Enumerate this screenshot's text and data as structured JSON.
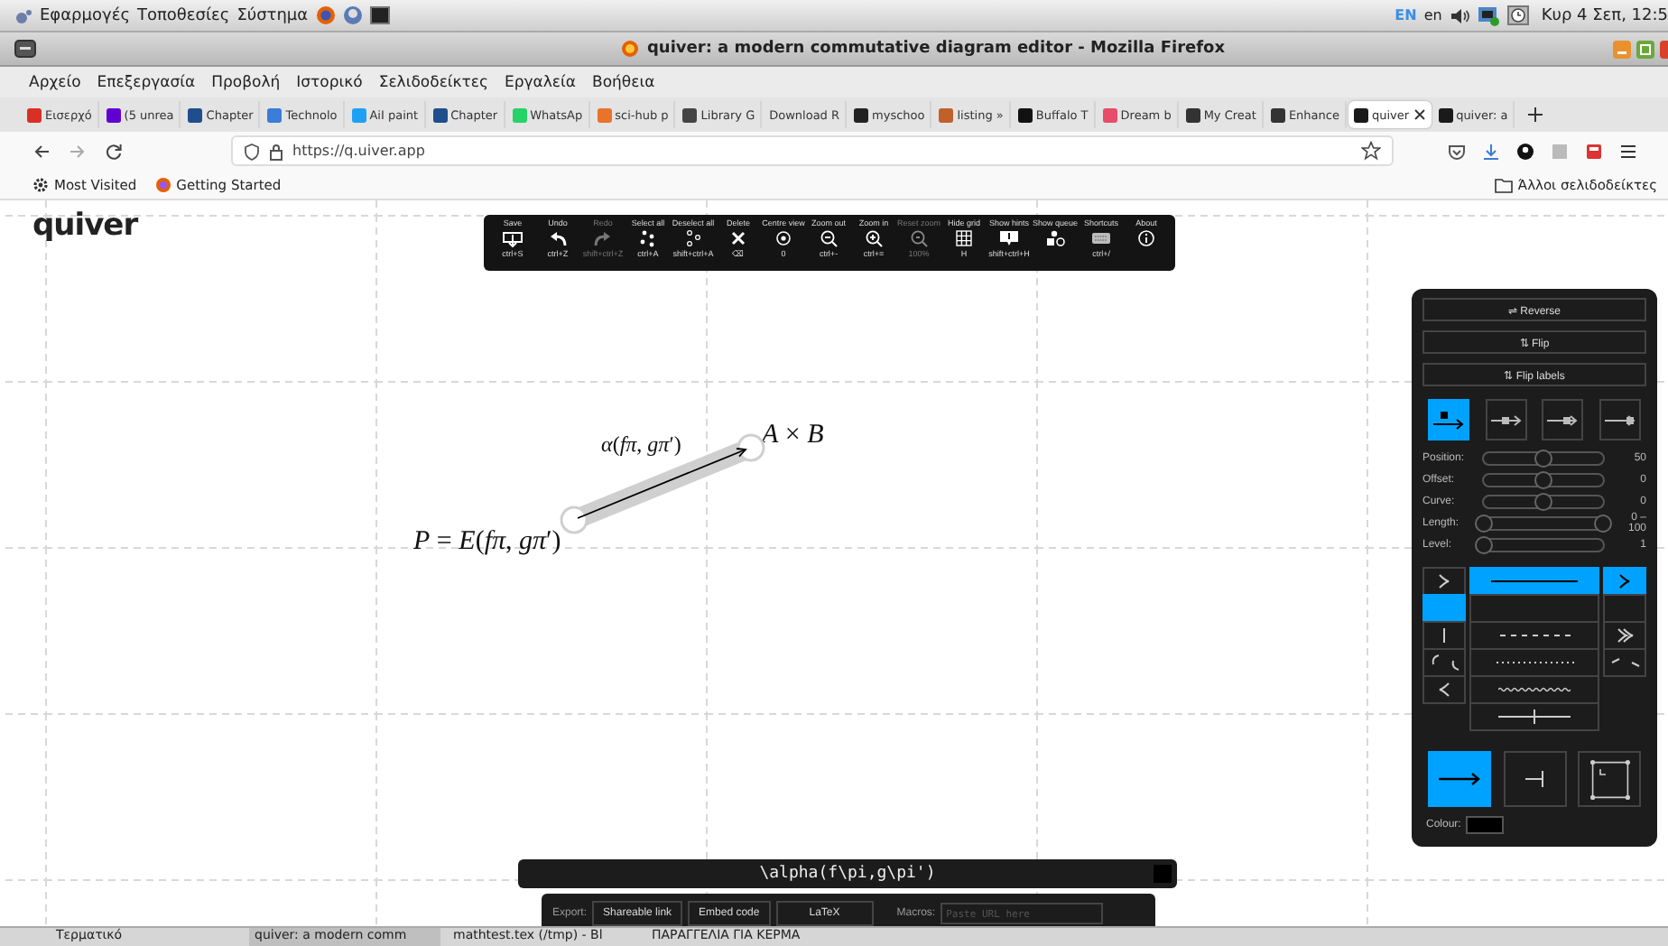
{
  "system_panel": {
    "menus": [
      "Εφαρμογές",
      "Τοποθεσίες",
      "Σύστημα"
    ],
    "keyboard_layout": "EN",
    "language": "en",
    "clock": "Κυρ  4 Σεπ, 12:5"
  },
  "window": {
    "title": "quiver: a modern commutative diagram editor - Mozilla Firefox"
  },
  "menu_bar": [
    "Αρχείο",
    "Επεξεργασία",
    "Προβολή",
    "Ιστορικό",
    "Σελιδοδείκτες",
    "Εργαλεία",
    "Βοήθεια"
  ],
  "tabs": [
    {
      "label": "Εισερχό",
      "selected": false,
      "color": "#d93025"
    },
    {
      "label": "(5 unrea",
      "selected": false,
      "color": "#6001d2"
    },
    {
      "label": "Chapter",
      "selected": false,
      "color": "#1f4e8c"
    },
    {
      "label": "Technolo",
      "selected": false,
      "color": "#3b7dd8"
    },
    {
      "label": "AiI paint",
      "selected": false,
      "color": "#1da1f2"
    },
    {
      "label": "Chapter",
      "selected": false,
      "color": "#1f4e8c"
    },
    {
      "label": "WhatsAp",
      "selected": false,
      "color": "#25d366"
    },
    {
      "label": "sci-hub p",
      "selected": false,
      "color": "#e8732a"
    },
    {
      "label": "Library G",
      "selected": false,
      "color": "#444444"
    },
    {
      "label": "Download R",
      "selected": false
    },
    {
      "label": "myschoo",
      "selected": false,
      "color": "#222222"
    },
    {
      "label": "listing »",
      "selected": false,
      "color": "#c0602a"
    },
    {
      "label": "Buffalo T",
      "selected": false,
      "color": "#111111"
    },
    {
      "label": "Dream b",
      "selected": false,
      "color": "#e94b6a"
    },
    {
      "label": "My Creat",
      "selected": false,
      "color": "#333333"
    },
    {
      "label": "Enhance",
      "selected": false,
      "color": "#333333"
    },
    {
      "label": "quiver",
      "selected": true,
      "color": "#1a1a1a"
    },
    {
      "label": "quiver: a",
      "selected": false,
      "color": "#1a1a1a"
    }
  ],
  "address_bar": {
    "url": "https://q.uiver.app"
  },
  "bookmarks": [
    {
      "label": "Most Visited",
      "kind": "gear"
    },
    {
      "label": "Getting Started",
      "kind": "firefox"
    }
  ],
  "other_bookmarks": "Άλλοι σελιδοδείκτες",
  "app": {
    "logo": "quiver",
    "toolbar": [
      {
        "label": "Save",
        "shortcut": "ctrl+S",
        "kind": "save",
        "disabled": false
      },
      {
        "label": "Undo",
        "shortcut": "ctrl+Z",
        "kind": "undo",
        "disabled": false
      },
      {
        "label": "Redo",
        "shortcut": "shift+ctrl+Z",
        "kind": "redo",
        "disabled": true
      },
      {
        "label": "Select all",
        "shortcut": "ctrl+A",
        "kind": "select_all",
        "disabled": false
      },
      {
        "label": "Deselect all",
        "shortcut": "shift+ctrl+A",
        "kind": "deselect_all",
        "disabled": false
      },
      {
        "label": "Delete",
        "shortcut": "⌫",
        "kind": "delete",
        "disabled": false
      },
      {
        "label": "Centre view",
        "shortcut": "0",
        "kind": "centre",
        "disabled": false
      },
      {
        "label": "Zoom out",
        "shortcut": "ctrl+-",
        "kind": "zoom_out",
        "disabled": false
      },
      {
        "label": "Zoom in",
        "shortcut": "ctrl+=",
        "kind": "zoom_in",
        "disabled": false
      },
      {
        "label": "Reset zoom",
        "shortcut": "100%",
        "kind": "reset_zoom",
        "disabled": true
      },
      {
        "label": "Hide grid",
        "shortcut": "H",
        "kind": "grid",
        "disabled": false
      },
      {
        "label": "Show hints",
        "shortcut": "shift+ctrl+H",
        "kind": "hints",
        "disabled": false
      },
      {
        "label": "Show queue",
        "kind": "queue",
        "disabled": false
      },
      {
        "label": "Shortcuts",
        "shortcut": "ctrl+/",
        "kind": "shortcuts",
        "disabled": false
      },
      {
        "label": "About",
        "kind": "about",
        "disabled": false
      }
    ],
    "diagram": {
      "objects": [
        {
          "label": "*P* = *E*(*fπ*, *gπ*′)"
        },
        {
          "label": "*A* × *B*"
        }
      ],
      "arrow": {
        "label": "*α*(*fπ*, *gπ*′)",
        "selected": true
      }
    },
    "panel": {
      "buttons": [
        {
          "label": "⇌ Reverse"
        },
        {
          "label": "⇅ Flip"
        },
        {
          "label": "⇅ Flip labels"
        }
      ],
      "label_positions": [
        {
          "kind": "left",
          "selected": true
        },
        {
          "kind": "centre",
          "selected": false
        },
        {
          "kind": "over",
          "selected": false
        },
        {
          "kind": "right",
          "selected": false
        }
      ],
      "sliders": [
        {
          "label": "Position:",
          "reading": "50",
          "thumbs": [
            {
              "level": 0.5
            }
          ]
        },
        {
          "label": "Offset:",
          "reading": "0",
          "thumbs": [
            {
              "level": 0.5
            }
          ]
        },
        {
          "label": "Curve:",
          "reading": "0",
          "thumbs": [
            {
              "level": 0.5
            }
          ]
        },
        {
          "label": "Length:",
          "reading": "0 – 100",
          "thumbs": [
            {
              "level": 0
            },
            {
              "level": 1
            }
          ]
        },
        {
          "label": "Level:",
          "reading": "1",
          "thumbs": [
            {
              "level": 0
            }
          ]
        }
      ],
      "tails": [
        {
          "kind": "arrowhead",
          "selected": false
        },
        {
          "kind": "none",
          "selected": true
        },
        {
          "kind": "maps_to",
          "selected": false
        },
        {
          "kind": "hooks",
          "selected": false
        },
        {
          "kind": "reverse_arrowhead",
          "selected": false
        }
      ],
      "bodies": [
        {
          "kind": "solid",
          "selected": true
        },
        {
          "kind": "none",
          "selected": false
        },
        {
          "kind": "dashed",
          "selected": false
        },
        {
          "kind": "dotted",
          "selected": false
        },
        {
          "kind": "squiggly",
          "selected": false
        },
        {
          "kind": "barred",
          "selected": false
        }
      ],
      "heads": [
        {
          "kind": "arrowhead",
          "selected": true
        },
        {
          "kind": "none",
          "selected": false
        },
        {
          "kind": "double",
          "selected": false
        },
        {
          "kind": "harpoons",
          "selected": false
        }
      ],
      "edge_types": [
        {
          "kind": "arrow",
          "selected": true
        },
        {
          "kind": "adjunction",
          "selected": false
        },
        {
          "kind": "pullback",
          "selected": false
        }
      ],
      "colour": {
        "label": "Colour:",
        "color": "#000000"
      }
    },
    "label_input": {
      "value": "\\alpha(f\\pi,g\\pi')",
      "color": "#000000"
    },
    "export": {
      "label": "Export:",
      "buttons": [
        {
          "label": "Shareable link"
        },
        {
          "label": "Embed code"
        },
        {
          "label": "LaTeX"
        }
      ],
      "macros": {
        "label": "Macros:",
        "placeholder": "Paste URL here"
      }
    }
  },
  "taskbar": [
    {
      "label": "Τερματικό",
      "selected": false
    },
    {
      "label": "quiver: a modern comm",
      "selected": true
    },
    {
      "label": "mathtest.tex (/tmp) - Bl",
      "selected": false
    },
    {
      "label": "ΠΑΡΑΓΓΕΛΙΑ ΓΙΑ ΚΕΡΜΑ",
      "selected": false
    }
  ]
}
